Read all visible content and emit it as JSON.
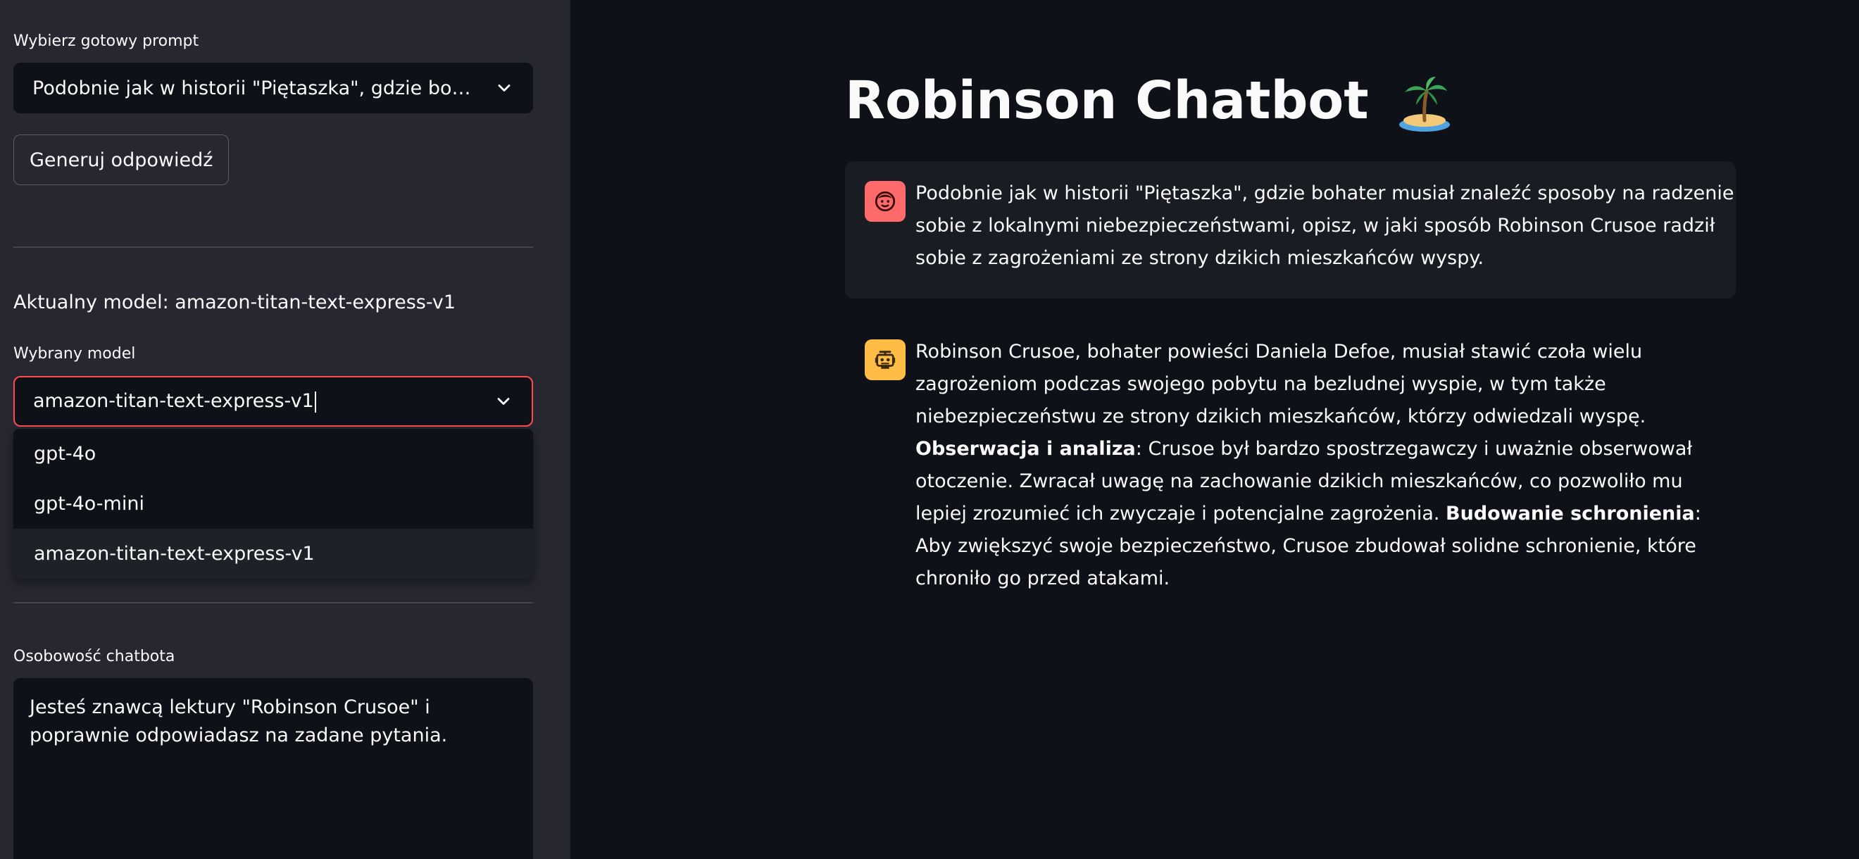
{
  "sidebar": {
    "prompt_label": "Wybierz gotowy prompt",
    "prompt_selected": "Podobnie jak w historii \"Piętaszka\", gdzie bohater musiał znaleźć sposoby na radzenie sobie z lokalnymi niebezpieczeństwami, opisz, w jaki sposób Robinson Crusoe radził sobie z zagrożeniami ze strony dzikich mieszkańców wyspy.",
    "generate_button": "Generuj odpowiedź",
    "current_model_text": "Aktualny model: amazon-titan-text-express-v1",
    "model_label": "Wybrany model",
    "model_input_value": "amazon-titan-text-express-v1",
    "model_options": [
      {
        "label": "gpt-4o"
      },
      {
        "label": "gpt-4o-mini"
      },
      {
        "label": "amazon-titan-text-express-v1"
      }
    ],
    "personality_label": "Osobowość chatbota",
    "personality_value": "Jesteś znawcą lektury \"Robinson Crusoe\" i poprawnie odpowiadasz na zadane pytania."
  },
  "main": {
    "title": "Robinson Chatbot",
    "title_icon": "desert-island-emoji",
    "user_message": "Podobnie jak w historii \"Piętaszka\", gdzie bohater musiał znaleźć sposoby na radzenie sobie z lokalnymi niebezpieczeństwami, opisz, w jaki sposób Robinson Crusoe radził sobie z zagrożeniami ze strony dzikich mieszkańców wyspy.",
    "bot_message": {
      "intro": "Robinson Crusoe, bohater powieści Daniela Defoe, musiał stawić czoła wielu zagrożeniom podczas swojego pobytu na bezludnej wyspie, w tym także niebezpieczeństwu ze strony dzikich mieszkańców, którzy odwiedzali wyspę. ",
      "point1_title": "Obserwacja i analiza",
      "point1_text": ": Crusoe był bardzo spostrzegawczy i uważnie obserwował otoczenie. Zwracał uwagę na zachowanie dzikich mieszkańców, co pozwoliło mu lepiej zrozumieć ich zwyczaje i potencjalne zagrożenia. ",
      "point2_title": "Budowanie schronienia",
      "point2_text": ": Aby zwiększyć swoje bezpieczeństwo, Crusoe zbudował solidne schronienie, które chroniło go przed atakami."
    }
  },
  "colors": {
    "sidebar_bg": "#262730",
    "main_bg": "#0e1117",
    "focus_border": "#ff4b4b",
    "user_avatar": "#ff6b6b",
    "bot_avatar": "#ffbd45"
  }
}
